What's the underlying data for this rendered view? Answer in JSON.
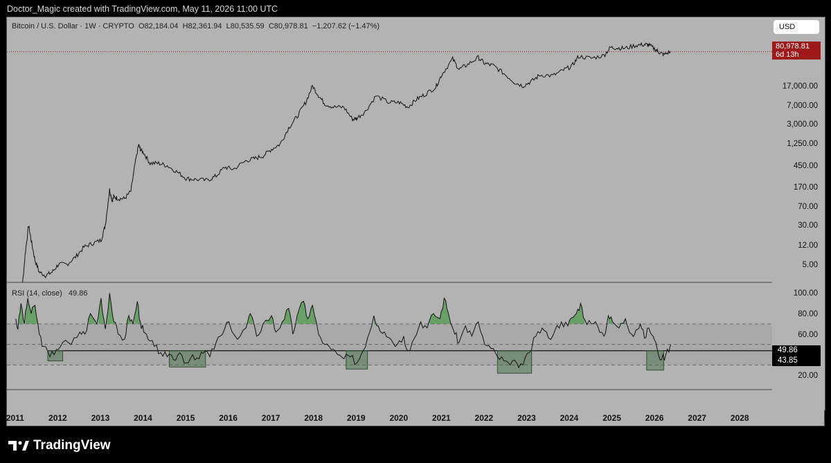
{
  "header": {
    "attribution": "Doctor_Magic created with TradingView.com, May 11, 2026 11:00 UTC"
  },
  "footer": {
    "brand": "TradingView",
    "logo_icon": "tradingview-logo-icon"
  },
  "colors": {
    "chart_bg": "#b3b3b3",
    "price_line": "#9e1a1a",
    "rsi_overbought_fill": "#4f9a4f",
    "rsi_oversold_box": "#3b6b3b"
  },
  "chart_data": [
    {
      "type": "line",
      "title": "Bitcoin / U.S. Dollar · 1W · CRYPTO",
      "ohlc": {
        "open": "O82,184.04",
        "high": "H82,361.94",
        "low": "L80,535.59",
        "close": "C80,978.81",
        "change": "−1,207.62 (−1.47%)"
      },
      "currency": "USD",
      "last_price": "80,978.81",
      "countdown": "6d 13h",
      "y_scale": "log",
      "ylim": [
        2.2,
        160000
      ],
      "yticks": [
        "17,000.00",
        "7,000.00",
        "3,000.00",
        "1,250.00",
        "450.00",
        "170.00",
        "70.00",
        "30.00",
        "12.00",
        "5.00"
      ],
      "x": [
        2011.0,
        2011.12,
        2011.22,
        2011.3,
        2011.36,
        2011.45,
        2011.55,
        2011.7,
        2011.85,
        2012.0,
        2012.2,
        2012.4,
        2012.6,
        2012.8,
        2013.0,
        2013.1,
        2013.2,
        2013.26,
        2013.3,
        2013.4,
        2013.55,
        2013.7,
        2013.8,
        2013.88,
        2013.92,
        2014.0,
        2014.15,
        2014.35,
        2014.55,
        2014.8,
        2015.0,
        2015.2,
        2015.5,
        2015.7,
        2015.9,
        2016.1,
        2016.4,
        2016.6,
        2016.8,
        2017.0,
        2017.2,
        2017.4,
        2017.6,
        2017.8,
        2017.96,
        2018.1,
        2018.25,
        2018.45,
        2018.7,
        2018.9,
        2019.0,
        2019.2,
        2019.45,
        2019.75,
        2020.0,
        2020.2,
        2020.4,
        2020.6,
        2020.85,
        2021.0,
        2021.25,
        2021.4,
        2021.6,
        2021.85,
        2022.0,
        2022.2,
        2022.45,
        2022.7,
        2022.9,
        2023.1,
        2023.3,
        2023.6,
        2023.85,
        2024.05,
        2024.2,
        2024.5,
        2024.8,
        2024.95,
        2025.1,
        2025.3,
        2025.55,
        2025.75,
        2025.85,
        2026.0,
        2026.1,
        2026.2,
        2026.36
      ],
      "close": [
        0.3,
        0.9,
        8,
        30,
        15,
        6,
        3.5,
        3,
        3.5,
        5,
        5,
        7,
        11,
        13,
        15,
        30,
        150,
        90,
        110,
        100,
        100,
        140,
        500,
        1150,
        950,
        800,
        500,
        500,
        450,
        330,
        250,
        240,
        230,
        280,
        420,
        380,
        560,
        620,
        700,
        950,
        1200,
        2500,
        4200,
        8000,
        17000,
        11000,
        7500,
        6500,
        6400,
        3700,
        3900,
        5300,
        10800,
        8000,
        8000,
        6500,
        9200,
        11500,
        16000,
        29000,
        58000,
        36000,
        45000,
        62000,
        47000,
        43000,
        30000,
        20000,
        17000,
        21000,
        28000,
        27000,
        35000,
        42000,
        65000,
        60000,
        68000,
        98000,
        96000,
        94000,
        108000,
        112000,
        110000,
        90000,
        78000,
        70000,
        81000
      ]
    },
    {
      "type": "line",
      "title": "RSI (14, close)",
      "last_value": "49.86",
      "reference_value": "43.85",
      "levels": [
        70,
        50,
        30
      ],
      "ylim": [
        6,
        107
      ],
      "yticks": [
        "100.00",
        "80.00",
        "60.00",
        "20.00"
      ],
      "x": [
        2011.0,
        2011.05,
        2011.12,
        2011.2,
        2011.28,
        2011.36,
        2011.45,
        2011.55,
        2011.65,
        2011.8,
        2011.95,
        2012.1,
        2012.3,
        2012.5,
        2012.62,
        2012.75,
        2012.9,
        2013.0,
        2013.1,
        2013.2,
        2013.3,
        2013.4,
        2013.55,
        2013.65,
        2013.75,
        2013.85,
        2013.92,
        2014.0,
        2014.1,
        2014.25,
        2014.4,
        2014.55,
        2014.7,
        2014.85,
        2015.0,
        2015.15,
        2015.3,
        2015.45,
        2015.55,
        2015.7,
        2015.85,
        2016.0,
        2016.2,
        2016.4,
        2016.5,
        2016.65,
        2016.8,
        2017.0,
        2017.1,
        2017.25,
        2017.4,
        2017.5,
        2017.6,
        2017.75,
        2017.85,
        2017.96,
        2018.1,
        2018.25,
        2018.4,
        2018.55,
        2018.7,
        2018.85,
        2019.0,
        2019.1,
        2019.25,
        2019.4,
        2019.5,
        2019.65,
        2019.8,
        2019.95,
        2020.1,
        2020.2,
        2020.35,
        2020.5,
        2020.65,
        2020.8,
        2020.95,
        2021.05,
        2021.15,
        2021.3,
        2021.4,
        2021.55,
        2021.7,
        2021.85,
        2022.0,
        2022.15,
        2022.3,
        2022.45,
        2022.6,
        2022.75,
        2022.9,
        2023.05,
        2023.2,
        2023.35,
        2023.5,
        2023.65,
        2023.8,
        2023.95,
        2024.05,
        2024.15,
        2024.25,
        2024.35,
        2024.5,
        2024.65,
        2024.8,
        2024.9,
        2025.0,
        2025.15,
        2025.3,
        2025.45,
        2025.55,
        2025.65,
        2025.75,
        2025.85,
        2025.95,
        2026.05,
        2026.15,
        2026.25,
        2026.36
      ],
      "values": [
        75,
        65,
        90,
        70,
        95,
        80,
        88,
        60,
        48,
        38,
        45,
        52,
        50,
        62,
        60,
        80,
        70,
        95,
        65,
        100,
        72,
        60,
        55,
        78,
        70,
        92,
        72,
        62,
        55,
        48,
        42,
        38,
        35,
        42,
        32,
        40,
        36,
        44,
        38,
        52,
        60,
        72,
        55,
        66,
        80,
        58,
        70,
        78,
        62,
        72,
        85,
        60,
        78,
        92,
        75,
        88,
        60,
        50,
        45,
        40,
        36,
        38,
        32,
        40,
        56,
        78,
        68,
        62,
        55,
        50,
        58,
        44,
        56,
        72,
        66,
        80,
        75,
        95,
        80,
        60,
        52,
        68,
        58,
        72,
        50,
        46,
        38,
        34,
        30,
        32,
        30,
        42,
        58,
        66,
        56,
        64,
        72,
        68,
        76,
        80,
        90,
        74,
        70,
        68,
        58,
        78,
        72,
        66,
        75,
        60,
        64,
        70,
        56,
        66,
        58,
        45,
        35,
        40,
        49.86
      ]
    }
  ],
  "x_axis": {
    "years": [
      "2011",
      "2012",
      "2013",
      "2014",
      "2015",
      "2016",
      "2017",
      "2018",
      "2019",
      "2020",
      "2021",
      "2022",
      "2023",
      "2024",
      "2025",
      "2026",
      "2027",
      "2028"
    ]
  }
}
